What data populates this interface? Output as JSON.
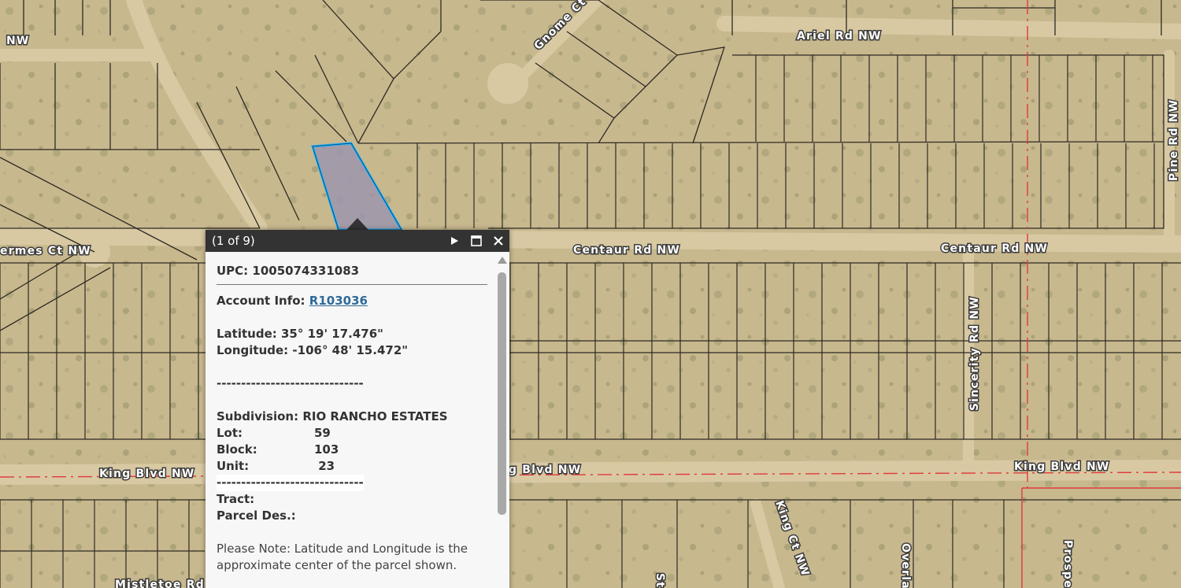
{
  "map": {
    "road_labels": {
      "ariel": "Ariel Rd NW",
      "gnome": "Gnome Ct",
      "pine": "Pine Rd NW",
      "centaur_1": "Centaur Rd NW",
      "centaur_2": "Centaur Rd NW",
      "hermes": "ermes Ct NW",
      "nw_top_left": "NW",
      "sincerity": "Sincerity Rd NW",
      "king_1": "King Blvd NW",
      "king_2": "g Blvd NW",
      "king_3": "King Blvd NW",
      "king_ct": "King Ct NW",
      "overland": "Overlan",
      "prospect": "Prospe",
      "mistletoe": "Mistletoe Rd",
      "st": "St"
    },
    "colors": {
      "terrain": "#c9b98f",
      "parcel_line": "#2d2a22",
      "selected_outline": "#1fb6ff",
      "selected_fill": "#9b93b0",
      "city_limit": "#e03a3a"
    }
  },
  "popup": {
    "title": "(1 of 9)",
    "controls": {
      "next_icon": "play-icon",
      "maximize_icon": "maximize-icon",
      "close_icon": "close-icon"
    },
    "upc_label": "UPC:",
    "upc_value": "1005074331083",
    "account_label": "Account Info:",
    "account_value": "R103036",
    "latitude_label": "Latitude:",
    "latitude_value": "35° 19' 17.476\"",
    "longitude_label": "Longitude:",
    "longitude_value": "-106° 48' 15.472\"",
    "separator": "------------------------------",
    "subdivision_label": "Subdivision:",
    "subdivision_value": "RIO RANCHO ESTATES",
    "lot_label": "Lot:",
    "lot_value": "59",
    "block_label": "Block:",
    "block_value": "103",
    "unit_label": "Unit:",
    "unit_value": " 23",
    "tract_label": "Tract:",
    "parcel_des_label": "Parcel Des.:",
    "note": "Please Note: Latitude and Longitude is the approximate center of the parcel shown."
  }
}
